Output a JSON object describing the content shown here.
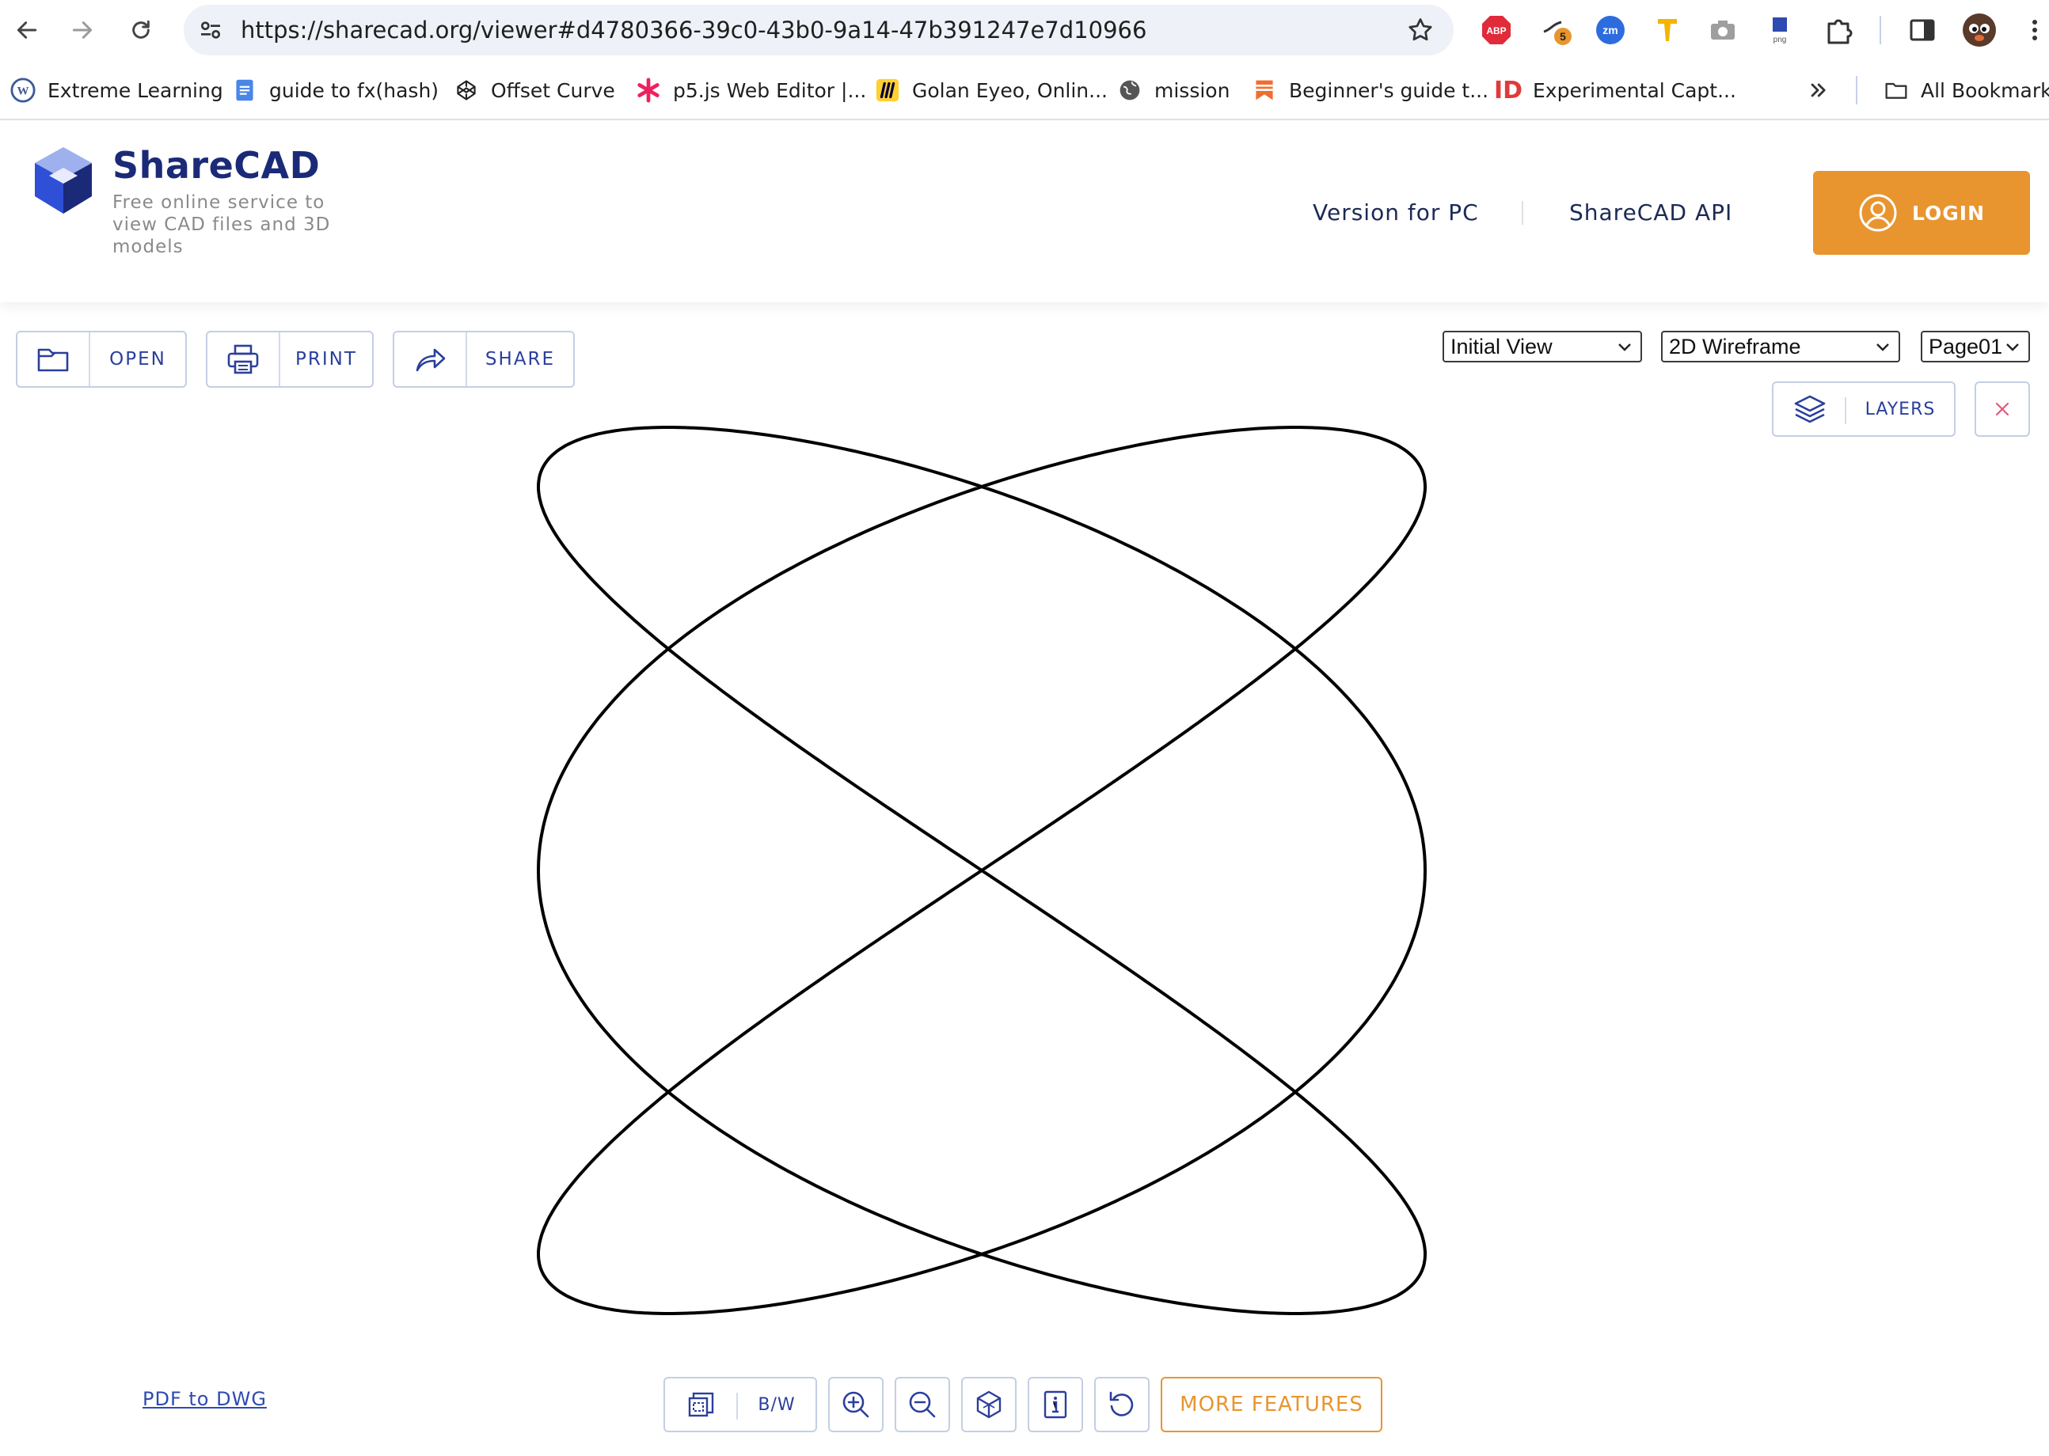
{
  "browser": {
    "url": "https://sharecad.org/viewer#d4780366-39c0-43b0-9a14-47b391247e7d10966",
    "extensions": [
      {
        "name": "adblock-icon",
        "text": "ABP"
      },
      {
        "name": "extension-badge-icon",
        "badge": "5"
      },
      {
        "name": "zoom-extension-icon",
        "text": "zm"
      },
      {
        "name": "pen-extension-icon"
      },
      {
        "name": "camera-extension-icon"
      },
      {
        "name": "png-extension-icon",
        "text": "png"
      },
      {
        "name": "puzzle-icon"
      },
      {
        "name": "side-panel-icon"
      },
      {
        "name": "profile-avatar"
      }
    ],
    "bookmarks": [
      {
        "label": "Extreme Learning"
      },
      {
        "label": "guide to fx(hash)"
      },
      {
        "label": "Offset Curve"
      },
      {
        "label": "p5.js Web Editor |..."
      },
      {
        "label": "Golan Eyeo, Onlin..."
      },
      {
        "label": "mission"
      },
      {
        "label": "Beginner's guide t..."
      },
      {
        "label": "Experimental Capt..."
      }
    ],
    "all_bookmarks": "All Bookmarks",
    "bookmark_icon_text": {
      "id": "ID"
    }
  },
  "header": {
    "brand": "ShareCAD",
    "tagline": "Free online service to view CAD files and 3D models",
    "links": [
      "Version for PC",
      "ShareCAD API"
    ],
    "login": "LOGIN"
  },
  "toolbar": {
    "open": "OPEN",
    "print": "PRINT",
    "share": "SHARE",
    "view_select": "Initial View",
    "mode_select": "2D Wireframe",
    "page_select": "Page01",
    "layers": "LAYERS"
  },
  "footer": {
    "pdf_link": "PDF to DWG",
    "bw": "B/W",
    "more": "MORE FEATURES"
  },
  "colors": {
    "brand": "#1b2a78",
    "accent": "#e8952f",
    "button_text": "#2b3f9c",
    "button_border": "#c3cfe2"
  }
}
